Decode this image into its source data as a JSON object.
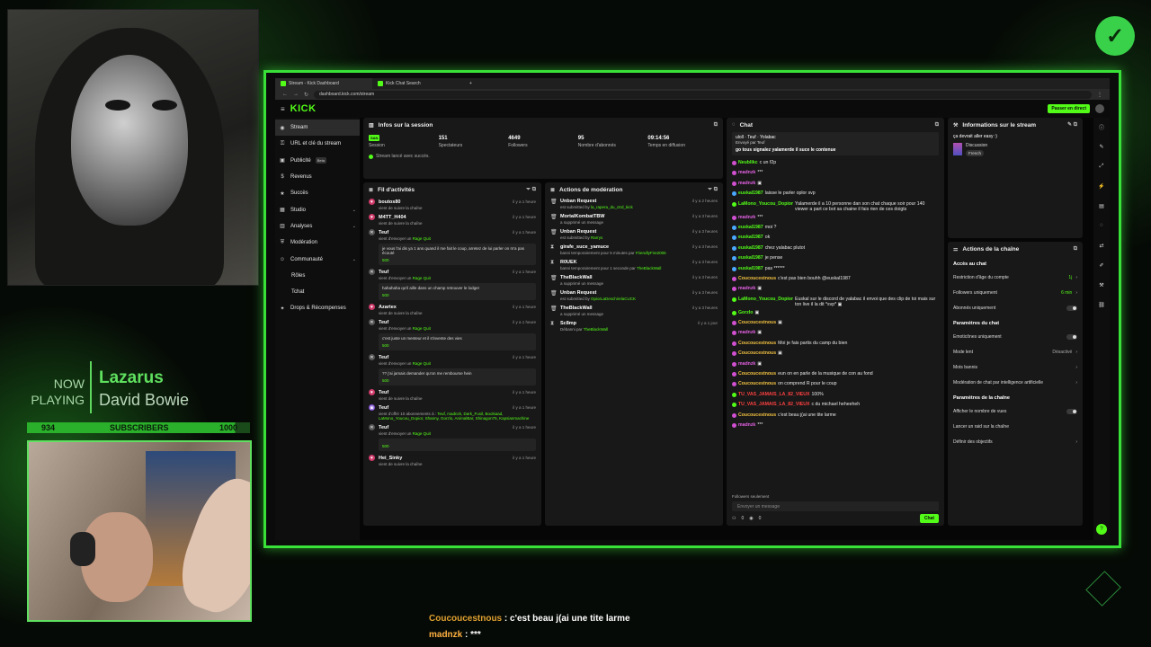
{
  "overlay": {
    "now_playing_label": "NOW PLAYING",
    "track_title": "Lazarus",
    "track_artist": "David Bowie",
    "subs_current": "934",
    "subs_label": "SUBSCRIBERS",
    "subs_goal": "1000",
    "subs_progress": 0.934,
    "chat_lines": [
      {
        "user": "Coucoucestnous",
        "text": " : c'est beau j(ai une tite larme"
      },
      {
        "user": "madnzk",
        "text": " : ***"
      }
    ]
  },
  "browser": {
    "tabs": [
      {
        "title": "Stream - Kick Dashboard"
      },
      {
        "title": "Kick Chat Search"
      }
    ],
    "new_tab": "+",
    "url": "dashboard.kick.com/stream"
  },
  "kick": {
    "logo": "KICK",
    "live_button": "Passer en direct"
  },
  "sidenav": [
    {
      "label": "Stream",
      "icon": "broadcast-icon",
      "glyph": "◉",
      "active": true,
      "chevron": false,
      "sub": false,
      "beta": ""
    },
    {
      "label": "URL et clé du stream",
      "icon": "key-icon",
      "glyph": "⚿",
      "active": false,
      "chevron": false,
      "sub": false,
      "beta": ""
    },
    {
      "label": "Publicité",
      "icon": "ad-icon",
      "glyph": "▣",
      "active": false,
      "chevron": false,
      "sub": false,
      "beta": "Beta"
    },
    {
      "label": "Revenus",
      "icon": "money-icon",
      "glyph": "$",
      "active": false,
      "chevron": false,
      "sub": false,
      "beta": ""
    },
    {
      "label": "Succès",
      "icon": "trophy-icon",
      "glyph": "★",
      "active": false,
      "chevron": false,
      "sub": false,
      "beta": ""
    },
    {
      "label": "Studio",
      "icon": "studio-icon",
      "glyph": "▦",
      "active": false,
      "chevron": true,
      "sub": false,
      "beta": ""
    },
    {
      "label": "Analyses",
      "icon": "chart-icon",
      "glyph": "▥",
      "active": false,
      "chevron": true,
      "sub": false,
      "beta": ""
    },
    {
      "label": "Modération",
      "icon": "shield-icon",
      "glyph": "⛨",
      "active": false,
      "chevron": false,
      "sub": false,
      "beta": ""
    },
    {
      "label": "Communauté",
      "icon": "users-icon",
      "glyph": "☺",
      "active": false,
      "chevron": true,
      "sub": false,
      "beta": ""
    },
    {
      "label": "Rôles",
      "icon": "",
      "glyph": "",
      "active": false,
      "chevron": false,
      "sub": true,
      "beta": ""
    },
    {
      "label": "Tchat",
      "icon": "",
      "glyph": "",
      "active": false,
      "chevron": false,
      "sub": true,
      "beta": ""
    },
    {
      "label": "Drops & Récompenses",
      "icon": "gift-icon",
      "glyph": "✦",
      "active": false,
      "chevron": false,
      "sub": false,
      "beta": ""
    }
  ],
  "session": {
    "title": "Infos sur la session",
    "lang": "SAN",
    "stats": [
      {
        "value": "",
        "label": "Session"
      },
      {
        "value": "151",
        "label": "Spectateurs"
      },
      {
        "value": "4649",
        "label": "Followers"
      },
      {
        "value": "95",
        "label": "Nombre d'abonnés"
      },
      {
        "value": "09:14:56",
        "label": "Temps en diffusion"
      }
    ],
    "status": "Stream lancé avec succès."
  },
  "feed": {
    "title": "Fil d'activités",
    "items": [
      {
        "icon": "heart-icon",
        "glyph": "♥",
        "color": "#d03a6a",
        "name": "boutos80",
        "time": "il y a 1 heure",
        "sub": "vient de suivre la chaîne",
        "hl": "",
        "msg": "",
        "coin": ""
      },
      {
        "icon": "heart-icon",
        "glyph": "♥",
        "color": "#d03a6a",
        "name": "M4TT_H404",
        "time": "il y a 1 heure",
        "sub": "vient de suivre la chaîne",
        "hl": "",
        "msg": "",
        "coin": ""
      },
      {
        "icon": "close-circle-icon",
        "glyph": "✕",
        "color": "#555",
        "name": "Teuf",
        "time": "il y a 1 heure",
        "sub": "vient d'envoyer un",
        "hl": "Rage Quit",
        "msg": "je vous l'ai dis ya 1 ans quand il me fait le coup, arretez de lui parler on m'a pas écouté",
        "coin": "500"
      },
      {
        "icon": "close-circle-icon",
        "glyph": "✕",
        "color": "#555",
        "name": "Teuf",
        "time": "il y a 1 heure",
        "sub": "vient d'envoyer un",
        "hl": "Rage Quit",
        "msg": "hahahaha qu'il aille dans un champ retrouver le lodger",
        "coin": "500"
      },
      {
        "icon": "heart-icon",
        "glyph": "♥",
        "color": "#d03a6a",
        "name": "Azartex",
        "time": "il y a 1 heure",
        "sub": "vient de suivre la chaîne",
        "hl": "",
        "msg": "",
        "coin": ""
      },
      {
        "icon": "close-circle-icon",
        "glyph": "✕",
        "color": "#555",
        "name": "Teuf",
        "time": "il y a 1 heure",
        "sub": "vient d'envoyer un",
        "hl": "Rage Quit",
        "msg": "c'est juste un menteur et il s'invente des vies",
        "coin": "500"
      },
      {
        "icon": "close-circle-icon",
        "glyph": "✕",
        "color": "#555",
        "name": "Teuf",
        "time": "il y a 1 heure",
        "sub": "vient d'envoyer un",
        "hl": "Rage Quit",
        "msg": "?? j'ai jamais demander qu'on me rembourse hein",
        "coin": "500"
      },
      {
        "icon": "heart-icon",
        "glyph": "♥",
        "color": "#d03a6a",
        "name": "Teuf",
        "time": "il y a 1 heure",
        "sub": "vient de suivre la chaîne",
        "hl": "",
        "msg": "",
        "coin": ""
      },
      {
        "icon": "gift-icon",
        "glyph": "▣",
        "color": "#7a4ad0",
        "name": "Teuf",
        "time": "il y a 1 heure",
        "sub": "vient d'offrir 10 abonnements à :",
        "hl": "Teuf, madnzk, Dark_Fusil, Boolsaad, LaMono_Youcou_Dopior, Shanny, Gorzlo, AnimalBar, Shinagon75, Kapsianmachine",
        "msg": "",
        "coin": ""
      },
      {
        "icon": "close-circle-icon",
        "glyph": "✕",
        "color": "#555",
        "name": "Teuf",
        "time": "il y a 1 heure",
        "sub": "vient d'envoyer un",
        "hl": "Rage Quit",
        "msg": "",
        "coin": "500"
      },
      {
        "icon": "heart-icon",
        "glyph": "♥",
        "color": "#d03a6a",
        "name": "Hei_Sinky",
        "time": "il y a 1 heure",
        "sub": "vient de suivre la chaîne",
        "hl": "",
        "msg": "",
        "coin": ""
      }
    ]
  },
  "moderation": {
    "title": "Actions de modération",
    "items": [
      {
        "icon": "trash-icon",
        "glyph": "🗑",
        "name": "Unban Request",
        "time": "il y a 2 heures",
        "sub": "est submitted by",
        "hl": "la_rapera_du_ctrd_kick"
      },
      {
        "icon": "trash-icon",
        "glyph": "🗑",
        "name": "MortalKombatTBW",
        "time": "il y a 3 heures",
        "sub": "a supprimé un message",
        "hl": ""
      },
      {
        "icon": "trash-icon",
        "glyph": "🗑",
        "name": "Unban Request",
        "time": "il y a 3 heures",
        "sub": "est submitted by",
        "hl": "Rarrys"
      },
      {
        "icon": "hourglass-icon",
        "glyph": "⧗",
        "name": "girafe_suce_yamuce",
        "time": "il y a 3 heures",
        "sub": "banni temporairement pour 5 minutes par",
        "hl": "FriendlyFire2005"
      },
      {
        "icon": "hourglass-icon",
        "glyph": "⧗",
        "name": "R0UEK",
        "time": "il y a 3 heures",
        "sub": "banni temporairement pour 1 seconde par",
        "hl": "TheBlackWall"
      },
      {
        "icon": "trash-icon",
        "glyph": "🗑",
        "name": "TheBlackWall",
        "time": "il y a 3 heures",
        "sub": "a supprimé un message",
        "hl": ""
      },
      {
        "icon": "trash-icon",
        "glyph": "🗑",
        "name": "Unban Request",
        "time": "il y a 3 heures",
        "sub": "est submitted by",
        "hl": "OpiorLaDeschirelaCUCK"
      },
      {
        "icon": "trash-icon",
        "glyph": "🗑",
        "name": "TheBlackWall",
        "time": "il y a 3 heures",
        "sub": "a supprimé un message",
        "hl": ""
      },
      {
        "icon": "hourglass-icon",
        "glyph": "⧗",
        "name": "Sc8mp",
        "time": "il y a 1 jour",
        "sub": "Débanni par",
        "hl": "TheBlackWall"
      }
    ]
  },
  "chat": {
    "title": "Chat",
    "pinned_users": "uloll · Teuf · Yolabac",
    "pinned_by": "Envoyé par Teuf",
    "pinned_msg": "go tous signalez yalamerde il suce le contenue",
    "messages": [
      {
        "user": "Neublikc",
        "color": "#53fc18",
        "badge": "",
        "text": " c un f2p"
      },
      {
        "user": "madnzk",
        "color": "#e060e0",
        "badge": "",
        "text": " ***"
      },
      {
        "user": "madnzk",
        "color": "#e060e0",
        "badge": "",
        "text": " ▣"
      },
      {
        "user": "euskal1987",
        "color": "#53fc18",
        "badge": "b",
        "text": " laisse le parler oplor svp"
      },
      {
        "user": "LaMono_Youcou_Dopior",
        "color": "#53fc18",
        "badge": "g",
        "text": " Yalamerde il a 10 personne dan son chat chaque soir pour 140 viewer a part ce bot sa chaine il fais rien de ces doigts"
      },
      {
        "user": "madnzk",
        "color": "#e060e0",
        "badge": "",
        "text": " ***"
      },
      {
        "user": "euskal1987",
        "color": "#53fc18",
        "badge": "b",
        "text": " moi ?"
      },
      {
        "user": "euskal1987",
        "color": "#53fc18",
        "badge": "b",
        "text": " ok"
      },
      {
        "user": "euskal1987",
        "color": "#53fc18",
        "badge": "b",
        "text": " chez yalabac plutot"
      },
      {
        "user": "euskal1987",
        "color": "#53fc18",
        "badge": "b",
        "text": " je pense"
      },
      {
        "user": "euskal1987",
        "color": "#53fc18",
        "badge": "b",
        "text": " pas ******"
      },
      {
        "user": "Coucoucestnous",
        "color": "#f0c040",
        "badge": "",
        "text": " c'est pas bien bouhh @euskal1987"
      },
      {
        "user": "madnzk",
        "color": "#e060e0",
        "badge": "",
        "text": " ▣"
      },
      {
        "user": "LaMono_Youcou_Dopior",
        "color": "#53fc18",
        "badge": "g",
        "text": " Euskal sur le discord de yalabac il envoi que des clip de toi mais sur ton live il la dit *svp* ▣"
      },
      {
        "user": "Gorzlo",
        "color": "#53fc18",
        "badge": "g",
        "text": " ▣"
      },
      {
        "user": "Coucoucestnous",
        "color": "#f0c040",
        "badge": "",
        "text": " ▣"
      },
      {
        "user": "madnzk",
        "color": "#e060e0",
        "badge": "",
        "text": " ▣"
      },
      {
        "user": "Coucoucestnous",
        "color": "#f0c040",
        "badge": "",
        "text": " Moi je fais partis du camp du bien"
      },
      {
        "user": "Coucoucestnous",
        "color": "#f0c040",
        "badge": "",
        "text": " ▣"
      },
      {
        "user": "madnzk",
        "color": "#e060e0",
        "badge": "",
        "text": " ▣"
      },
      {
        "user": "Coucoucestnous",
        "color": "#f0c040",
        "badge": "",
        "text": " eun on en parle de la musique de con au fond"
      },
      {
        "user": "Coucoucestnous",
        "color": "#f0c040",
        "badge": "",
        "text": " on comprend R pour le coup"
      },
      {
        "user": "TU_VAS_JAMAIS_LA_82_VIEUX",
        "color": "#ff4040",
        "badge": "g",
        "text": " 100%"
      },
      {
        "user": "TU_VAS_JAMAIS_LA_82_VIEUX",
        "color": "#ff4040",
        "badge": "g",
        "text": " c du michael heheeheh"
      },
      {
        "user": "Coucoucestnous",
        "color": "#f0c040",
        "badge": "",
        "text": " c'est beau j(ai une tite larme"
      },
      {
        "user": "madnzk",
        "color": "#e060e0",
        "badge": "",
        "text": " ***"
      }
    ],
    "followers_only": "Followers seulement",
    "input_placeholder": "Envoyer un message",
    "viewer_count": "0",
    "points": "0",
    "send_label": "Chat"
  },
  "stream_info": {
    "title": "Informations sur le stream",
    "stream_title": "ça devrait aller easy :)",
    "category": "Discussion",
    "tag": "French"
  },
  "channel_actions": {
    "title": "Actions de la chaîne",
    "sections": [
      {
        "title": "Accès au chat",
        "rows": [
          {
            "label": "Restriction d'âge du compte",
            "value": "1j",
            "kind": "value"
          },
          {
            "label": "Followers uniquement",
            "value": "6 min",
            "kind": "value"
          },
          {
            "label": "Abonnés uniquement",
            "value": "",
            "kind": "toggle"
          }
        ]
      },
      {
        "title": "Paramètres du chat",
        "rows": [
          {
            "label": "Emoticônes uniquement",
            "value": "",
            "kind": "toggle"
          },
          {
            "label": "Mode lent",
            "value": "Désactivé",
            "kind": "grey"
          },
          {
            "label": "Mots bannis",
            "value": "",
            "kind": "chevron"
          },
          {
            "label": "Modération de chat par intelligence artificielle",
            "value": "",
            "kind": "chevron"
          }
        ]
      },
      {
        "title": "Paramètres de la chaîne",
        "rows": [
          {
            "label": "Afficher le nombre de vues",
            "value": "",
            "kind": "toggle"
          },
          {
            "label": "Lancer un raid sur la chaîne",
            "value": "",
            "kind": "none"
          },
          {
            "label": "Définir des objectifs",
            "value": "",
            "kind": "chevron"
          }
        ]
      }
    ]
  },
  "rail_icons": [
    "info-icon",
    "pencil-icon",
    "expand-icon",
    "flash-icon",
    "clipboard-icon",
    "chat-bubble-icon",
    "arrows-icon",
    "edit-icon",
    "wrench-icon",
    "link-icon"
  ]
}
